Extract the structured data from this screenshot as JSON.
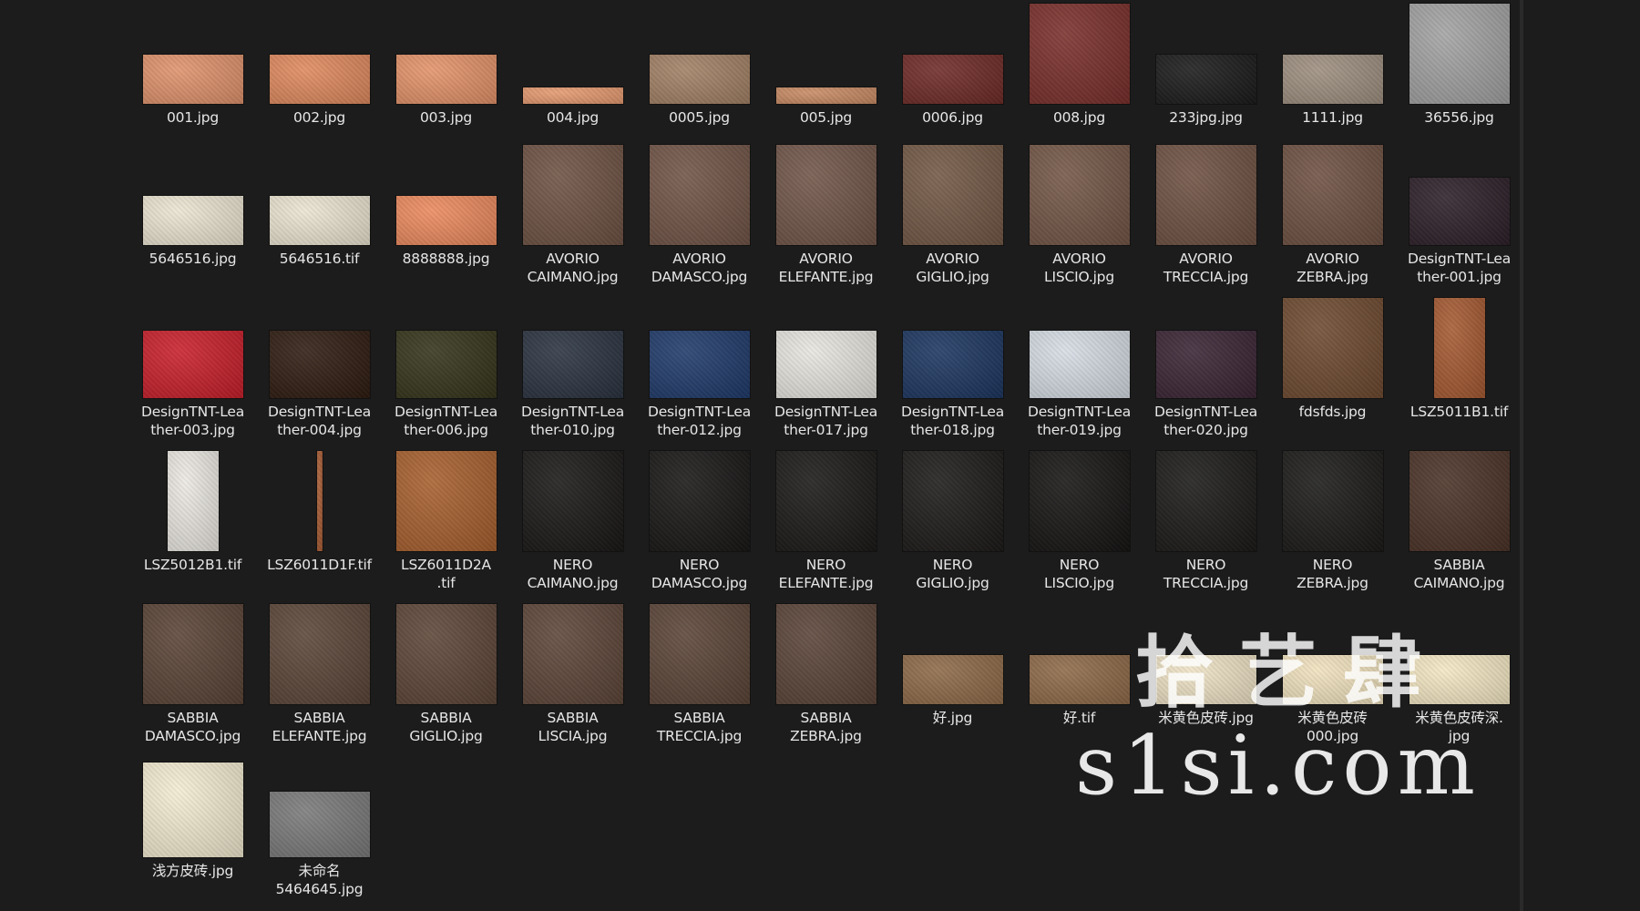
{
  "files": [
    {
      "name": "001.jpg",
      "color": "#e0936c"
    },
    {
      "name": "002.jpg",
      "color": "#e08a5e"
    },
    {
      "name": "003.jpg",
      "color": "#e49369"
    },
    {
      "name": "004.jpg",
      "color": "#e69a70"
    },
    {
      "name": "0005.jpg",
      "color": "#a38165"
    },
    {
      "name": "005.jpg",
      "color": "#c98b64"
    },
    {
      "name": "0006.jpg",
      "color": "#6e2a26"
    },
    {
      "name": "008.jpg",
      "color": "#7a2f2b"
    },
    {
      "name": "233jpg.jpg",
      "color": "#1a1a1a"
    },
    {
      "name": "1111.jpg",
      "color": "#9e8f80"
    },
    {
      "name": "36556.jpg",
      "color": "#a3a3a3"
    },
    {
      "name": "5646516.jpg",
      "color": "#ece5d2"
    },
    {
      "name": "5646516.tif",
      "color": "#ece5d2"
    },
    {
      "name": "8888888.jpg",
      "color": "#ec8a5e"
    },
    {
      "name": "AVORIO\nCAIMANO.jpg",
      "color": "#6e5243"
    },
    {
      "name": "AVORIO\nDAMASCO.jpg",
      "color": "#715446"
    },
    {
      "name": "AVORIO\nELEFANTE.jpg",
      "color": "#715548"
    },
    {
      "name": "AVORIO\nGIGLIO.jpg",
      "color": "#735845"
    },
    {
      "name": "AVORIO\nLISCIO.jpg",
      "color": "#735646"
    },
    {
      "name": "AVORIO\nTRECCIA.jpg",
      "color": "#6e5142"
    },
    {
      "name": "AVORIO\nZEBRA.jpg",
      "color": "#6e5142"
    },
    {
      "name": "DesignTNT-Lea\nther-001.jpg",
      "color": "#2c1f27"
    },
    {
      "name": "DesignTNT-Lea\nther-003.jpg",
      "color": "#c91f2a"
    },
    {
      "name": "DesignTNT-Lea\nther-004.jpg",
      "color": "#2e1b10"
    },
    {
      "name": "DesignTNT-Lea\nther-006.jpg",
      "color": "#34341a"
    },
    {
      "name": "DesignTNT-Lea\nther-010.jpg",
      "color": "#2a3340"
    },
    {
      "name": "DesignTNT-Lea\nther-012.jpg",
      "color": "#1f3a6a"
    },
    {
      "name": "DesignTNT-Lea\nther-017.jpg",
      "color": "#e8e6e0"
    },
    {
      "name": "DesignTNT-Lea\nther-018.jpg",
      "color": "#1c3660"
    },
    {
      "name": "DesignTNT-Lea\nther-019.jpg",
      "color": "#d6dde4"
    },
    {
      "name": "DesignTNT-Lea\nther-020.jpg",
      "color": "#3a2434"
    },
    {
      "name": "fdsfds.jpg",
      "color": "#6e4a30"
    },
    {
      "name": "LSZ5011B1.tif",
      "color": "#a65a32"
    },
    {
      "name": "LSZ5012B1.tif",
      "color": "#ece9e2"
    },
    {
      "name": "LSZ6011D1F.tif",
      "color": "#a65a32"
    },
    {
      "name": "LSZ6011D2A\n.tif",
      "color": "#a8602e"
    },
    {
      "name": "NERO\nCAIMANO.jpg",
      "color": "#191716"
    },
    {
      "name": "NERO\nDAMASCO.jpg",
      "color": "#171615"
    },
    {
      "name": "NERO\nELEFANTE.jpg",
      "color": "#191816"
    },
    {
      "name": "NERO\nGIGLIO.jpg",
      "color": "#1c1a18"
    },
    {
      "name": "NERO\nLISCIO.jpg",
      "color": "#151413"
    },
    {
      "name": "NERO\nTRECCIA.jpg",
      "color": "#1a1917"
    },
    {
      "name": "NERO\nZEBRA.jpg",
      "color": "#1a1917"
    },
    {
      "name": "SABBIA\nCAIMANO.jpg",
      "color": "#4a3226"
    },
    {
      "name": "SABBIA\nDAMASCO.jpg",
      "color": "#5a4336"
    },
    {
      "name": "SABBIA\nELEFANTE.jpg",
      "color": "#5b4538"
    },
    {
      "name": "SABBIA\nGIGLIO.jpg",
      "color": "#5d4537"
    },
    {
      "name": "SABBIA\nLISCIA.jpg",
      "color": "#5d4538"
    },
    {
      "name": "SABBIA\nTRECCIA.jpg",
      "color": "#5b4437"
    },
    {
      "name": "SABBIA\nZEBRA.jpg",
      "color": "#5a4337"
    },
    {
      "name": "好.jpg",
      "color": "#8e6a48"
    },
    {
      "name": "好.tif",
      "color": "#8e6a48"
    },
    {
      "name": "米黄色皮砖.jpg",
      "color": "#efe3c6"
    },
    {
      "name": "米黄色皮砖\n000.jpg",
      "color": "#f2e3bf"
    },
    {
      "name": "米黄色皮砖深.\njpg",
      "color": "#f5e8c4"
    },
    {
      "name": "浅方皮砖.jpg",
      "color": "#f4ecd2"
    },
    {
      "name": "未命名\n5464645.jpg",
      "color": "#7a7a7a"
    }
  ],
  "watermark": {
    "line1": "拾艺肆",
    "line2": "s1si.com"
  }
}
